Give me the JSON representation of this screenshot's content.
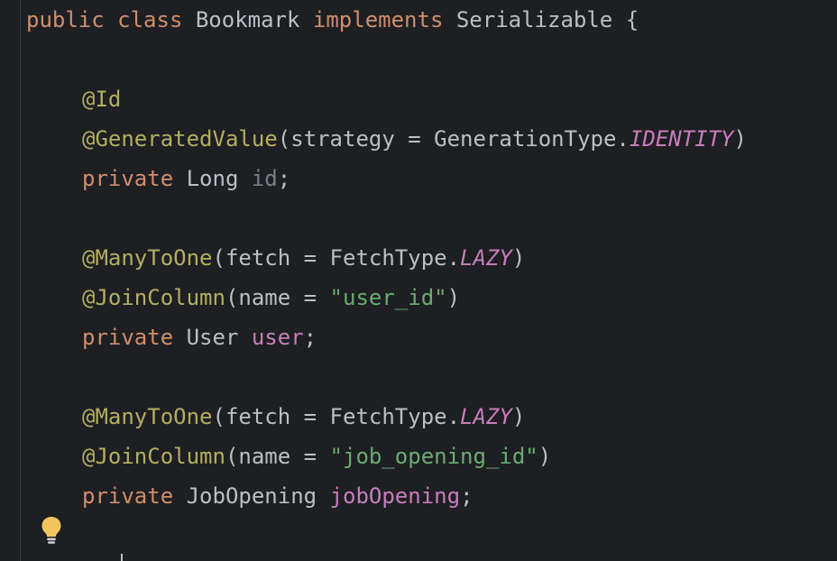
{
  "colors": {
    "background": "#1e1f22",
    "keyword": "#cf8e6d",
    "annotation": "#b3ae60",
    "field": "#c77dbb",
    "string": "#6aab73",
    "text": "#bcbec4",
    "unused": "#7a7e85"
  },
  "icons": {
    "gutter_bulb": "lightbulb-icon"
  },
  "code": {
    "line1": {
      "kw1": "public",
      "kw2": "class",
      "name": "Bookmark",
      "kw3": "implements",
      "iface": "Serializable",
      "brace": "{"
    },
    "line3": {
      "ann": "@Id"
    },
    "line4": {
      "ann": "@GeneratedValue",
      "pre": "(strategy = GenerationType.",
      "const": "IDENTITY",
      "post": ")"
    },
    "line5": {
      "kw": "private",
      "type": "Long",
      "field": "id",
      "semi": ";"
    },
    "line7": {
      "ann": "@ManyToOne",
      "pre": "(fetch = FetchType.",
      "const": "LAZY",
      "post": ")"
    },
    "line8": {
      "ann": "@JoinColumn",
      "pre": "(name = ",
      "str": "\"user_id\"",
      "post": ")"
    },
    "line9": {
      "kw": "private",
      "type": "User",
      "field": "user",
      "semi": ";"
    },
    "line11": {
      "ann": "@ManyToOne",
      "pre": "(fetch = FetchType.",
      "const": "LAZY",
      "post": ")"
    },
    "line12": {
      "ann": "@JoinColumn",
      "pre": "(name = ",
      "str": "\"job_opening_id\"",
      "post": ")"
    },
    "line13": {
      "kw": "private",
      "type": "JobOpening",
      "field": "jobOpening",
      "semi": ";"
    }
  }
}
